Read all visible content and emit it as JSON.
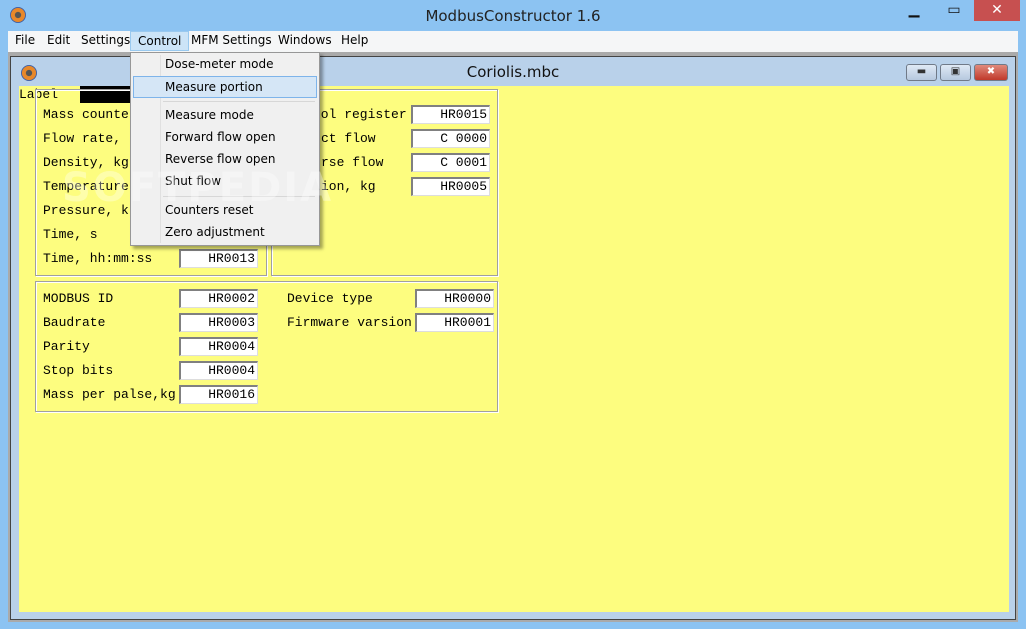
{
  "app": {
    "title": "ModbusConstructor 1.6",
    "minimize": "▁",
    "maximize": "▭",
    "close": "✕"
  },
  "menubar": [
    "File",
    "Edit",
    "Settings",
    "Control",
    "MFM Settings",
    "Windows",
    "Help"
  ],
  "control_menu": {
    "items": [
      "Dose-meter mode",
      "Measure portion",
      "Measure mode",
      "Forward flow open",
      "Reverse flow open",
      "Shut flow",
      "Counters reset",
      "Zero adjustment"
    ],
    "highlighted": "Measure portion"
  },
  "child": {
    "title": "Coriolis.mbc",
    "minimize": "▬",
    "restore": "▣",
    "close": "✖"
  },
  "label": "Label",
  "left_group": {
    "labels": [
      "Mass counte",
      "Flow rate,",
      "Density, kg",
      "Temperature",
      "Pressure, k",
      "Time, s",
      "Time, hh:mm:ss"
    ],
    "time_value": "HR0013"
  },
  "right_group": {
    "rows": [
      {
        "label": "rol register",
        "value": "HR0015"
      },
      {
        "label": "ct flow",
        "value": "C 0000"
      },
      {
        "label": "rse flow",
        "value": "C 0001"
      },
      {
        "label": "ion, kg",
        "value": "HR0005"
      }
    ]
  },
  "bottom_group": {
    "left": [
      {
        "label": "MODBUS ID",
        "value": "HR0002"
      },
      {
        "label": "Baudrate",
        "value": "HR0003"
      },
      {
        "label": "Parity",
        "value": "HR0004"
      },
      {
        "label": "Stop bits",
        "value": "HR0004"
      },
      {
        "label": "Mass per palse,kg",
        "value": "HR0016"
      }
    ],
    "right": [
      {
        "label": "Device type",
        "value": "HR0000"
      },
      {
        "label": "Firmware varsion",
        "value": "HR0001"
      }
    ]
  },
  "watermark": "SOFTPEDIA",
  "colors": {
    "client": "#fdfd7f",
    "titlebar": "#8cc3f2",
    "highlight": "#d5e6f6"
  }
}
